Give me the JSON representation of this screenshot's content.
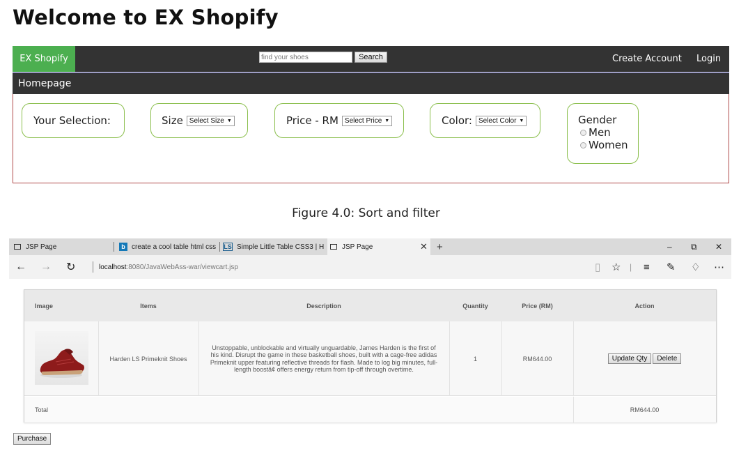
{
  "top": {
    "heading": "Welcome to EX Shopify",
    "brand": "EX Shopify",
    "search": {
      "placeholder": "find your shoes",
      "button": "Search"
    },
    "nav": {
      "create_account": "Create Account",
      "login": "Login"
    },
    "subnav_title": "Homepage",
    "filters": {
      "selection_label": "Your Selection:",
      "size": {
        "label": "Size",
        "select": "Select Size"
      },
      "price": {
        "label": "Price - RM",
        "select": "Select Price"
      },
      "color": {
        "label": "Color:",
        "select": "Select Color"
      },
      "gender": {
        "label": "Gender",
        "options": [
          "Men",
          "Women"
        ]
      }
    },
    "caption": "Figure 4.0: Sort and filter"
  },
  "browser": {
    "tabs": [
      {
        "label": "JSP Page"
      },
      {
        "label": "create a cool table html css"
      },
      {
        "label": "Simple Little Table CSS3 | H"
      },
      {
        "label": "JSP Page"
      }
    ],
    "window_controls": {
      "minimize": "–",
      "restore": "⧉",
      "close": "✕"
    },
    "url_host": "localhost",
    "url_rest": ":8080/JavaWebAss-war/viewcart.jsp",
    "icons": [
      "back-icon",
      "forward-icon",
      "refresh-icon",
      "reading-view-icon",
      "favorite-icon",
      "hub-icon",
      "web-note-icon",
      "share-icon",
      "more-icon"
    ]
  },
  "cart": {
    "headers": [
      "Image",
      "Items",
      "Description",
      "Quantity",
      "Price (RM)",
      "Action"
    ],
    "row": {
      "item": "Harden LS Primeknit Shoes",
      "description": "Unstoppable, unblockable and virtually unguardable, James Harden is the first of his kind. Disrupt the game in these basketball shoes, built with a cage-free adidas Primeknit upper featuring reflective threads for flash. Made to log big minutes, full-length boostâ¢ offers energy return from tip-off through overtime.",
      "quantity": "1",
      "price": "RM644.00",
      "update_button": "Update Qty",
      "delete_button": "Delete"
    },
    "total_label": "Total",
    "total_value": "RM644.00",
    "purchase_button": "Purchase"
  },
  "colors": {
    "brand_green": "#4caf50",
    "navbar_dark": "#333333",
    "filter_border": "#8bbf4d",
    "panel_border": "#b04a4a"
  }
}
